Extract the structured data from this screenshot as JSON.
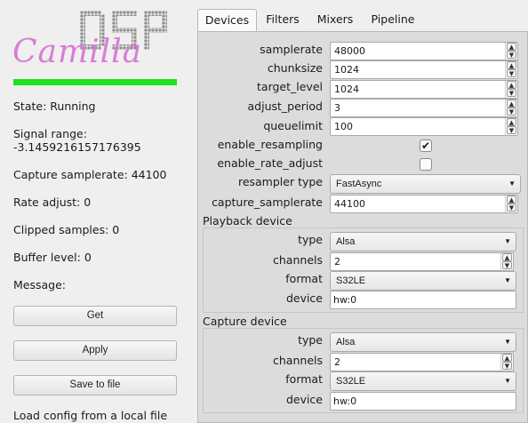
{
  "logo": {
    "script_text": "Camilla",
    "block_text": "DSP"
  },
  "status": {
    "state": "State: Running",
    "signal_range_label": "Signal range:",
    "signal_range_value": "-3.1459216157176395",
    "capture_samplerate": "Capture samplerate: 44100",
    "rate_adjust": "Rate adjust: 0",
    "clipped_samples": "Clipped samples: 0",
    "buffer_level": "Buffer level: 0",
    "message": "Message:",
    "state_color": "#1de21d"
  },
  "buttons": {
    "get": "Get",
    "apply": "Apply",
    "save": "Save to file",
    "load": "Load config from a local file"
  },
  "tabs": [
    "Devices",
    "Filters",
    "Mixers",
    "Pipeline"
  ],
  "devices": {
    "samplerate": {
      "label": "samplerate",
      "value": "48000"
    },
    "chunksize": {
      "label": "chunksize",
      "value": "1024"
    },
    "target_level": {
      "label": "target_level",
      "value": "1024"
    },
    "adjust_period": {
      "label": "adjust_period",
      "value": "3"
    },
    "queuelimit": {
      "label": "queuelimit",
      "value": "100"
    },
    "enable_resampling": {
      "label": "enable_resampling",
      "checked": true
    },
    "enable_rate_adjust": {
      "label": "enable_rate_adjust",
      "checked": false
    },
    "resampler_type": {
      "label": "resampler type",
      "value": "FastAsync"
    },
    "capture_samplerate": {
      "label": "capture_samplerate",
      "value": "44100"
    }
  },
  "playback": {
    "title": "Playback device",
    "type": {
      "label": "type",
      "value": "Alsa"
    },
    "channels": {
      "label": "channels",
      "value": "2"
    },
    "format": {
      "label": "format",
      "value": "S32LE"
    },
    "device": {
      "label": "device",
      "value": "hw:0"
    }
  },
  "capture": {
    "title": "Capture device",
    "type": {
      "label": "type",
      "value": "Alsa"
    },
    "channels": {
      "label": "channels",
      "value": "2"
    },
    "format": {
      "label": "format",
      "value": "S32LE"
    },
    "device": {
      "label": "device",
      "value": "hw:0"
    }
  }
}
